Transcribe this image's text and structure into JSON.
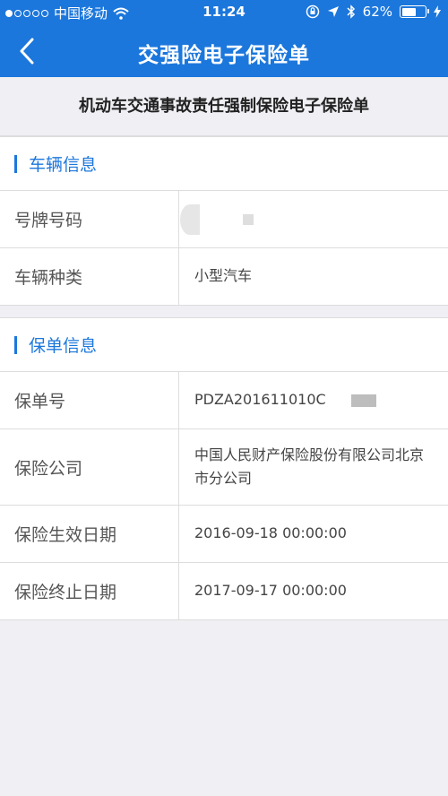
{
  "status_bar": {
    "carrier": "中国移动",
    "time": "11:24",
    "battery_percent": "62%",
    "battery_level": 0.62,
    "signal_bars": 1
  },
  "nav": {
    "back_icon": "chevron-left-icon",
    "title": "交强险电子保险单"
  },
  "document_title": "机动车交通事故责任强制保险电子保险单",
  "vehicle_section": {
    "title": "车辆信息",
    "rows": [
      {
        "label": "号牌号码",
        "value": ""
      },
      {
        "label": "车辆种类",
        "value": "小型汽车"
      }
    ]
  },
  "policy_section": {
    "title": "保单信息",
    "rows": [
      {
        "label": "保单号",
        "value": "PDZA201611010C"
      },
      {
        "label": "保险公司",
        "value": "中国人民财产保险股份有限公司北京市分公司"
      },
      {
        "label": "保险生效日期",
        "value": "2016-09-18 00:00:00"
      },
      {
        "label": "保险终止日期",
        "value": "2017-09-17 00:00:00"
      }
    ]
  },
  "colors": {
    "header_bg": "#1c77dc",
    "accent": "#1c77dc",
    "page_bg": "#efeff4"
  }
}
